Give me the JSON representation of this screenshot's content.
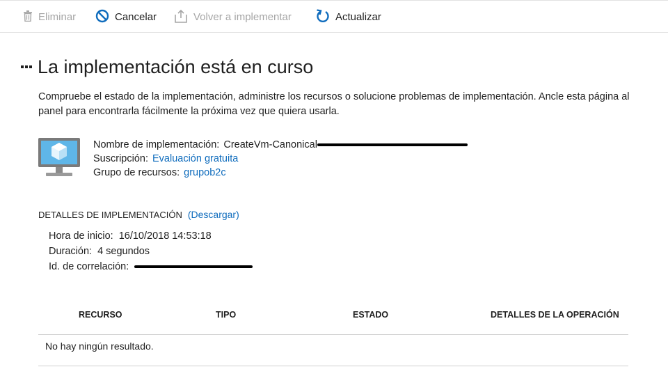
{
  "toolbar": {
    "delete_label": "Eliminar",
    "cancel_label": "Cancelar",
    "redeploy_label": "Volver a implementar",
    "refresh_label": "Actualizar"
  },
  "page": {
    "title": "La implementación está en curso",
    "description": "Compruebe el estado de la implementación, administre los recursos o solucione problemas de implementación. Ancle esta página al panel para encontrarla fácilmente la próxima vez que quiera usarla."
  },
  "summary": {
    "deployment_name_label": "Nombre de implementación:",
    "deployment_name_value": "CreateVm-Canonical",
    "subscription_label": "Suscripción:",
    "subscription_value": "Evaluación gratuita",
    "resource_group_label": "Grupo de recursos:",
    "resource_group_value": "grupob2c"
  },
  "details": {
    "heading": "DETALLES DE IMPLEMENTACIÓN",
    "download_link": "(Descargar)",
    "start_time_label": "Hora de inicio:",
    "start_time_value": "16/10/2018 14:53:18",
    "duration_label": "Duración:",
    "duration_value": "4 segundos",
    "correlation_label": "Id. de correlación:"
  },
  "table": {
    "columns": [
      "RECURSO",
      "TIPO",
      "ESTADO",
      "DETALLES DE LA OPERACIÓN"
    ],
    "empty_message": "No hay ningún resultado."
  },
  "icons": {
    "delete": "trash-icon",
    "cancel": "cancel-circle-icon",
    "redeploy": "upload-icon",
    "refresh": "refresh-icon",
    "resource": "virtual-machine-icon"
  },
  "colors": {
    "link": "#0f6cbd",
    "disabled": "#a6a6a6",
    "accent_icon": "#0f6cbd"
  }
}
